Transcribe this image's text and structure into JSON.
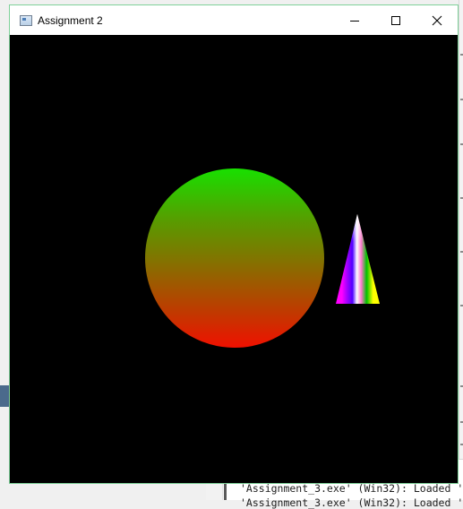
{
  "window": {
    "title": "Assignment 2",
    "controls": {
      "minimize": "minimize-icon",
      "maximize": "maximize-icon",
      "close": "close-icon"
    }
  },
  "scene": {
    "background": "#000000",
    "circle": {
      "top_color": "#18e000",
      "bottom_color": "#f01000"
    },
    "triangle": {
      "colors": [
        "#ff00ff",
        "#a000ff",
        "#5000ff",
        "#ffffff",
        "#00c000",
        "#ffff00"
      ]
    }
  },
  "background_ide": {
    "output_lines": [
      "'Assignment_3.exe' (Win32): Loaded '",
      "'Assignment_3.exe' (Win32): Loaded '"
    ]
  }
}
